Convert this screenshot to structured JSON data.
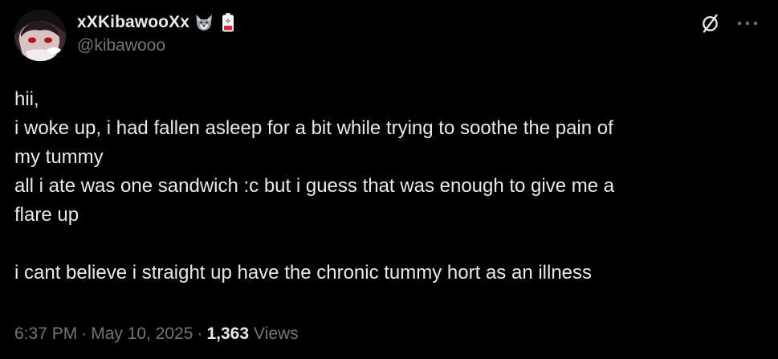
{
  "author": {
    "display_name": "xXKibawooXx",
    "handle": "@kibawooo",
    "badges": [
      "wolf-emoji",
      "low-battery-emoji"
    ]
  },
  "actions": {
    "grok_icon": "grok-slash-icon",
    "more_icon": "more-horizontal-icon"
  },
  "post": {
    "lines": [
      "hii,",
      "i woke up, i had fallen asleep for a bit while trying to soothe the pain of",
      "my tummy",
      "all i ate was one sandwich :c but i guess that was enough to give me a",
      "flare up",
      "",
      "i cant believe i straight up have the chronic tummy hort as an illness"
    ]
  },
  "meta": {
    "time": "6:37 PM",
    "separator": "·",
    "date": "May 10, 2025",
    "views_count": "1,363",
    "views_label": "Views"
  },
  "colors": {
    "background": "#000000",
    "primary_text": "#e7e9ea",
    "secondary_text": "#71767b"
  }
}
